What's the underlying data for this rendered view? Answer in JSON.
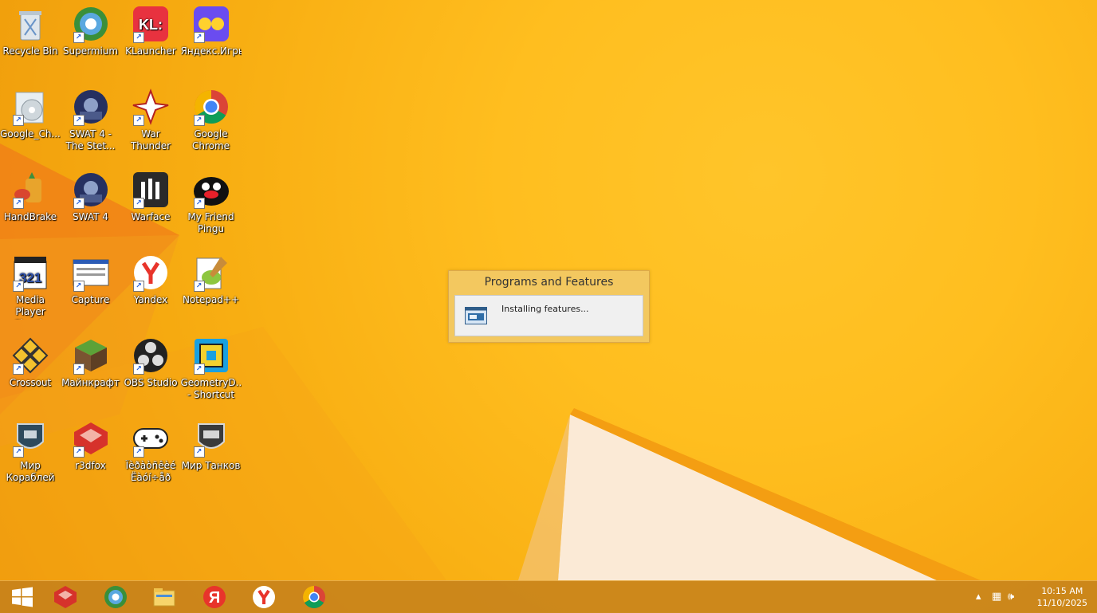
{
  "desktop": {
    "icons": [
      {
        "label": "Recycle Bin",
        "icon": "recycle-bin-icon"
      },
      {
        "label": "Supermium",
        "icon": "supermium-icon"
      },
      {
        "label": "KLauncher",
        "icon": "klauncher-icon",
        "art_text": "KL:"
      },
      {
        "label": "Яндекс.Игры",
        "icon": "yandex-games-icon"
      },
      {
        "label": "Google_Ch...",
        "icon": "google-chrome-installer-icon"
      },
      {
        "label": "SWAT 4 - The Stet...",
        "icon": "swat4-stetchkov-icon"
      },
      {
        "label": "War Thunder",
        "icon": "war-thunder-icon"
      },
      {
        "label": "Google Chrome",
        "icon": "google-chrome-icon"
      },
      {
        "label": "HandBrake",
        "icon": "handbrake-icon"
      },
      {
        "label": "SWAT 4",
        "icon": "swat4-icon"
      },
      {
        "label": "Warface",
        "icon": "warface-icon"
      },
      {
        "label": "My Friend Pingu",
        "icon": "pingu-icon"
      },
      {
        "label": "Media Player Classic",
        "icon": "media-player-classic-icon",
        "art_text": "321"
      },
      {
        "label": "Capture",
        "icon": "capture-icon"
      },
      {
        "label": "Yandex",
        "icon": "yandex-browser-icon"
      },
      {
        "label": "Notepad++",
        "icon": "notepad-plus-plus-icon"
      },
      {
        "label": "Crossout",
        "icon": "crossout-icon"
      },
      {
        "label": "Майнкрафт",
        "icon": "minecraft-icon"
      },
      {
        "label": "OBS Studio",
        "icon": "obs-studio-icon"
      },
      {
        "label": "GeometryD... - Shortcut",
        "icon": "geometry-dash-icon"
      },
      {
        "label": "Мир Кораблей",
        "icon": "mir-korabley-icon"
      },
      {
        "label": "r3dfox",
        "icon": "r3dfox-icon"
      },
      {
        "label": "Ïèðàòñêèé Ëàóí÷åð",
        "icon": "gamepad-icon"
      },
      {
        "label": "Мир Танков",
        "icon": "mir-tankov-icon"
      }
    ]
  },
  "dialog": {
    "title": "Programs and Features",
    "message": "Installing features..."
  },
  "taskbar": {
    "pinned": [
      {
        "name": "start",
        "icon": "windows-start-icon"
      },
      {
        "name": "r3dfox",
        "icon": "r3dfox-icon"
      },
      {
        "name": "supermium",
        "icon": "supermium-icon"
      },
      {
        "name": "file-explorer",
        "icon": "file-explorer-icon"
      },
      {
        "name": "yandex-music",
        "icon": "yandex-icon",
        "art_text": "Я"
      },
      {
        "name": "yandex-browser",
        "icon": "yandex-browser-icon"
      },
      {
        "name": "google-chrome",
        "icon": "google-chrome-icon"
      }
    ],
    "tray": {
      "time": "10:15 AM",
      "date": "11/10/2025"
    }
  },
  "colors": {
    "wallpaper": "#ffbe1f",
    "taskbar": "#c4801c",
    "dialog_frame": "#f3c85f"
  }
}
